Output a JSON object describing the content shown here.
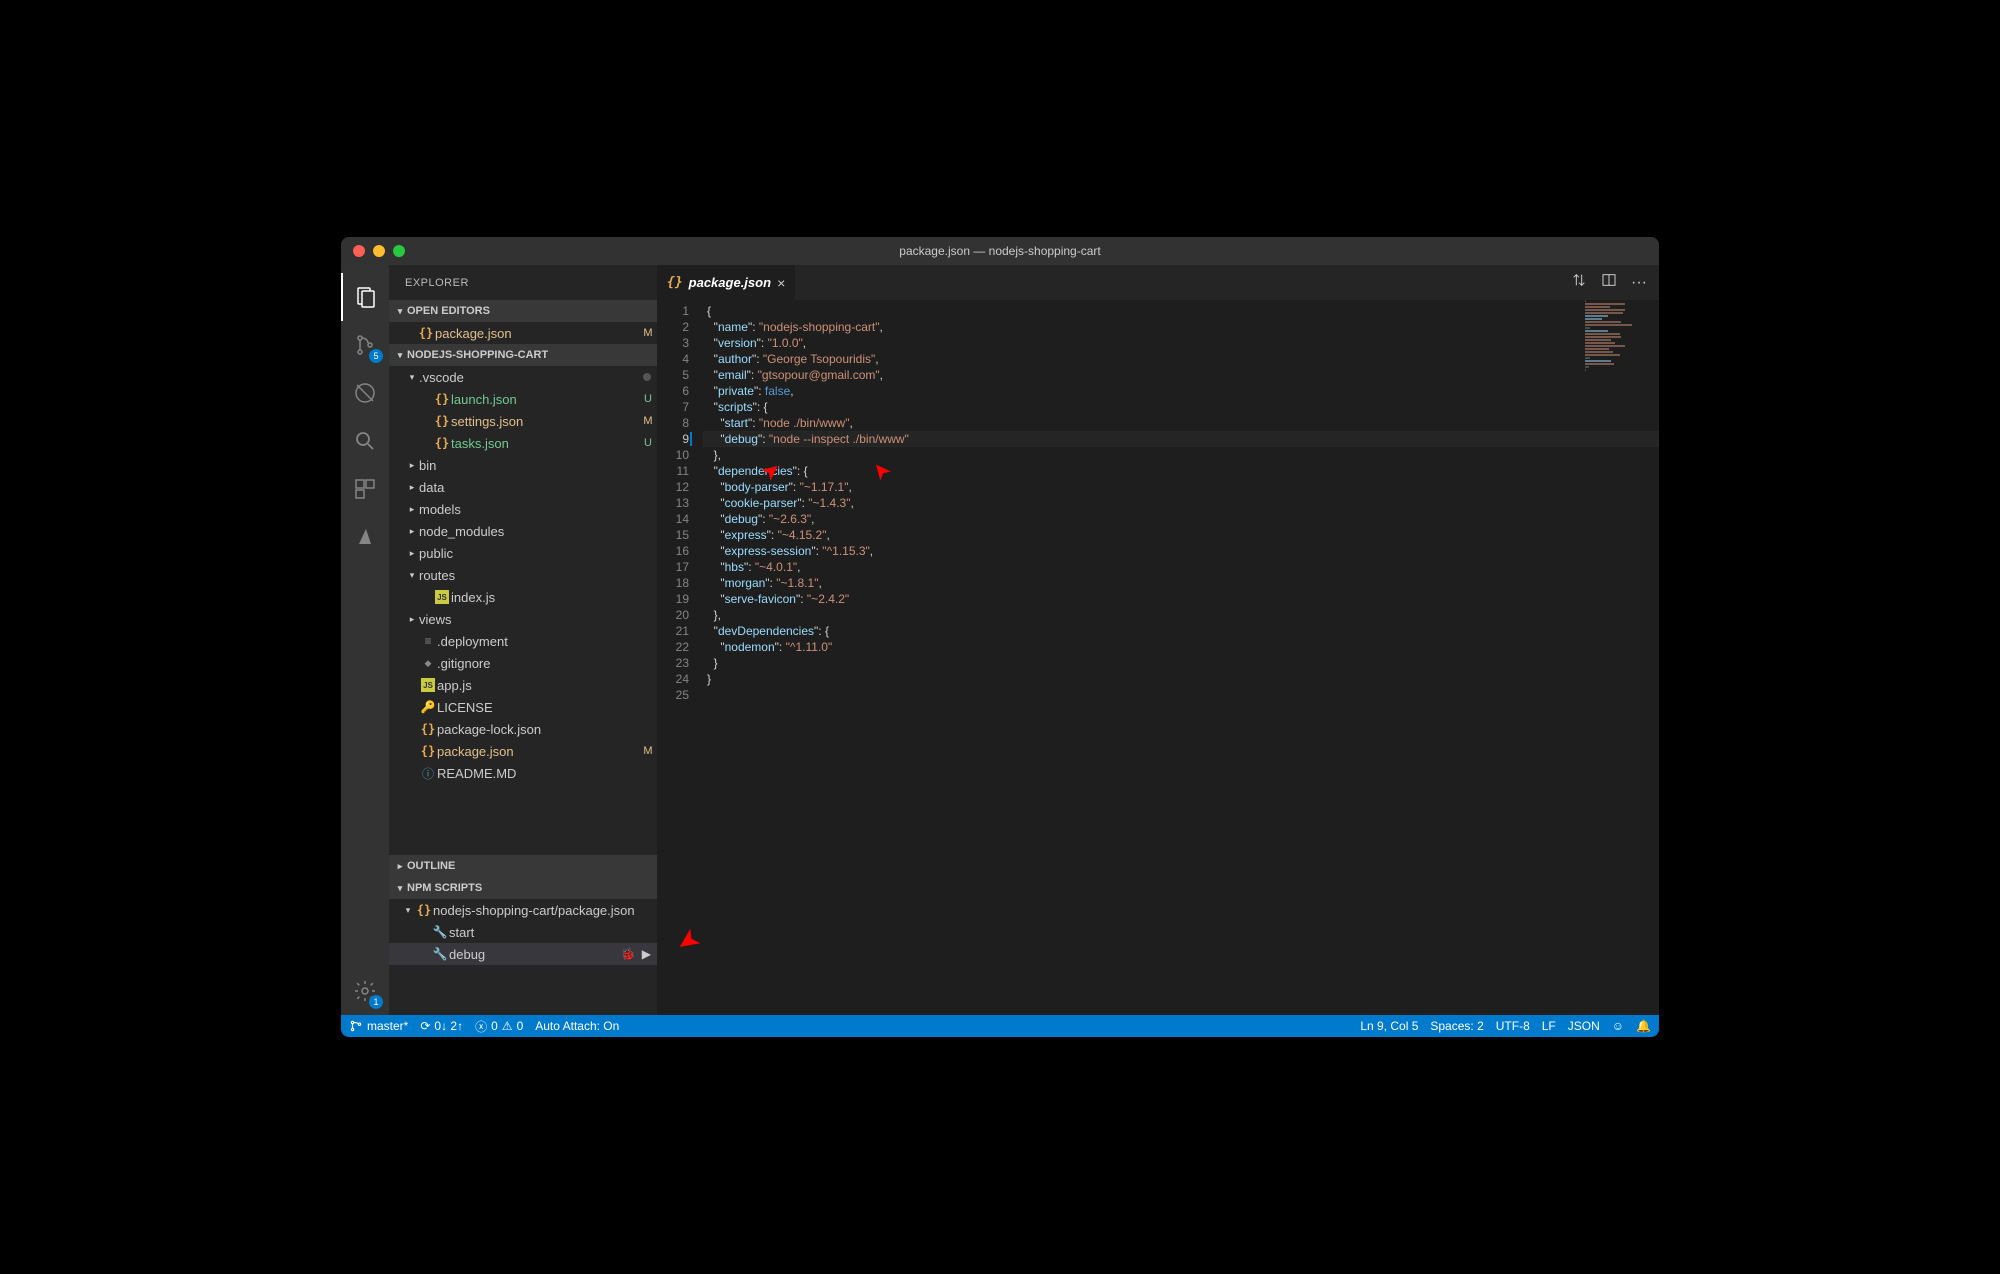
{
  "window": {
    "title": "package.json — nodejs-shopping-cart"
  },
  "activitybar": {
    "scm_badge": "5",
    "settings_badge": "1"
  },
  "sidebar": {
    "title": "EXPLORER",
    "sections": {
      "openEditors": {
        "label": "OPEN EDITORS",
        "items": [
          {
            "icon": "{}",
            "label": "package.json",
            "status": "M"
          }
        ]
      },
      "workspace": {
        "label": "NODEJS-SHOPPING-CART",
        "tree": [
          {
            "depth": 0,
            "tw": "▾",
            "icon": "",
            "label": ".vscode",
            "dot": true
          },
          {
            "depth": 1,
            "tw": "",
            "icon": "{}",
            "label": "launch.json",
            "status": "U",
            "git": "u"
          },
          {
            "depth": 1,
            "tw": "",
            "icon": "{}",
            "label": "settings.json",
            "status": "M",
            "git": "m"
          },
          {
            "depth": 1,
            "tw": "",
            "icon": "{}",
            "label": "tasks.json",
            "status": "U",
            "git": "u"
          },
          {
            "depth": 0,
            "tw": "▸",
            "icon": "",
            "label": "bin"
          },
          {
            "depth": 0,
            "tw": "▸",
            "icon": "",
            "label": "data"
          },
          {
            "depth": 0,
            "tw": "▸",
            "icon": "",
            "label": "models"
          },
          {
            "depth": 0,
            "tw": "▸",
            "icon": "",
            "label": "node_modules"
          },
          {
            "depth": 0,
            "tw": "▸",
            "icon": "",
            "label": "public"
          },
          {
            "depth": 0,
            "tw": "▾",
            "icon": "",
            "label": "routes"
          },
          {
            "depth": 1,
            "tw": "",
            "icon": "JS",
            "label": "index.js"
          },
          {
            "depth": 0,
            "tw": "▸",
            "icon": "",
            "label": "views"
          },
          {
            "depth": 0,
            "tw": "",
            "icon": "≡",
            "label": ".deployment"
          },
          {
            "depth": 0,
            "tw": "",
            "icon": "◆",
            "label": ".gitignore"
          },
          {
            "depth": 0,
            "tw": "",
            "icon": "JS",
            "label": "app.js"
          },
          {
            "depth": 0,
            "tw": "",
            "icon": "🔑",
            "label": "LICENSE"
          },
          {
            "depth": 0,
            "tw": "",
            "icon": "{}",
            "label": "package-lock.json"
          },
          {
            "depth": 0,
            "tw": "",
            "icon": "{}",
            "label": "package.json",
            "status": "M",
            "git": "m"
          },
          {
            "depth": 0,
            "tw": "",
            "icon": "ⓘ",
            "label": "README.MD"
          }
        ]
      },
      "outline": {
        "label": "OUTLINE"
      },
      "npm": {
        "label": "NPM SCRIPTS",
        "items": [
          {
            "depth": 0,
            "tw": "▾",
            "icon": "{}",
            "label": "nodejs-shopping-cart/package.json"
          },
          {
            "depth": 1,
            "tw": "",
            "icon": "🔧",
            "label": "start"
          },
          {
            "depth": 1,
            "tw": "",
            "icon": "🔧",
            "label": "debug",
            "selected": true,
            "actions": true
          }
        ]
      }
    }
  },
  "editor": {
    "tab": {
      "icon": "{}",
      "label": "package.json"
    },
    "currentLine": 9,
    "lines": [
      [
        {
          "t": "{",
          "c": ""
        }
      ],
      [
        {
          "t": "  \"",
          "c": ""
        },
        {
          "t": "name",
          "c": "k"
        },
        {
          "t": "\": ",
          "c": ""
        },
        {
          "t": "\"nodejs-shopping-cart\"",
          "c": "s"
        },
        {
          "t": ",",
          "c": ""
        }
      ],
      [
        {
          "t": "  \"",
          "c": ""
        },
        {
          "t": "version",
          "c": "k"
        },
        {
          "t": "\": ",
          "c": ""
        },
        {
          "t": "\"1.0.0\"",
          "c": "s"
        },
        {
          "t": ",",
          "c": ""
        }
      ],
      [
        {
          "t": "  \"",
          "c": ""
        },
        {
          "t": "author",
          "c": "k"
        },
        {
          "t": "\": ",
          "c": ""
        },
        {
          "t": "\"George Tsopouridis\"",
          "c": "s"
        },
        {
          "t": ",",
          "c": ""
        }
      ],
      [
        {
          "t": "  \"",
          "c": ""
        },
        {
          "t": "email",
          "c": "k"
        },
        {
          "t": "\": ",
          "c": ""
        },
        {
          "t": "\"gtsopour@gmail.com\"",
          "c": "s"
        },
        {
          "t": ",",
          "c": ""
        }
      ],
      [
        {
          "t": "  \"",
          "c": ""
        },
        {
          "t": "private",
          "c": "k"
        },
        {
          "t": "\": ",
          "c": ""
        },
        {
          "t": "false",
          "c": "c"
        },
        {
          "t": ",",
          "c": ""
        }
      ],
      [
        {
          "t": "  \"",
          "c": ""
        },
        {
          "t": "scripts",
          "c": "k"
        },
        {
          "t": "\": {",
          "c": ""
        }
      ],
      [
        {
          "t": "    \"",
          "c": ""
        },
        {
          "t": "start",
          "c": "k"
        },
        {
          "t": "\": ",
          "c": ""
        },
        {
          "t": "\"node ./bin/www\"",
          "c": "s"
        },
        {
          "t": ",",
          "c": ""
        }
      ],
      [
        {
          "t": "    \"",
          "c": ""
        },
        {
          "t": "debug",
          "c": "k"
        },
        {
          "t": "\": ",
          "c": ""
        },
        {
          "t": "\"node --inspect ./bin/www\"",
          "c": "s"
        }
      ],
      [
        {
          "t": "  },",
          "c": ""
        }
      ],
      [
        {
          "t": "  \"",
          "c": ""
        },
        {
          "t": "dependencies",
          "c": "k"
        },
        {
          "t": "\": {",
          "c": ""
        }
      ],
      [
        {
          "t": "    \"",
          "c": ""
        },
        {
          "t": "body-parser",
          "c": "k"
        },
        {
          "t": "\": ",
          "c": ""
        },
        {
          "t": "\"~1.17.1\"",
          "c": "s"
        },
        {
          "t": ",",
          "c": ""
        }
      ],
      [
        {
          "t": "    \"",
          "c": ""
        },
        {
          "t": "cookie-parser",
          "c": "k"
        },
        {
          "t": "\": ",
          "c": ""
        },
        {
          "t": "\"~1.4.3\"",
          "c": "s"
        },
        {
          "t": ",",
          "c": ""
        }
      ],
      [
        {
          "t": "    \"",
          "c": ""
        },
        {
          "t": "debug",
          "c": "k"
        },
        {
          "t": "\": ",
          "c": ""
        },
        {
          "t": "\"~2.6.3\"",
          "c": "s"
        },
        {
          "t": ",",
          "c": ""
        }
      ],
      [
        {
          "t": "    \"",
          "c": ""
        },
        {
          "t": "express",
          "c": "k"
        },
        {
          "t": "\": ",
          "c": ""
        },
        {
          "t": "\"~4.15.2\"",
          "c": "s"
        },
        {
          "t": ",",
          "c": ""
        }
      ],
      [
        {
          "t": "    \"",
          "c": ""
        },
        {
          "t": "express-session",
          "c": "k"
        },
        {
          "t": "\": ",
          "c": ""
        },
        {
          "t": "\"^1.15.3\"",
          "c": "s"
        },
        {
          "t": ",",
          "c": ""
        }
      ],
      [
        {
          "t": "    \"",
          "c": ""
        },
        {
          "t": "hbs",
          "c": "k"
        },
        {
          "t": "\": ",
          "c": ""
        },
        {
          "t": "\"~4.0.1\"",
          "c": "s"
        },
        {
          "t": ",",
          "c": ""
        }
      ],
      [
        {
          "t": "    \"",
          "c": ""
        },
        {
          "t": "morgan",
          "c": "k"
        },
        {
          "t": "\": ",
          "c": ""
        },
        {
          "t": "\"~1.8.1\"",
          "c": "s"
        },
        {
          "t": ",",
          "c": ""
        }
      ],
      [
        {
          "t": "    \"",
          "c": ""
        },
        {
          "t": "serve-favicon",
          "c": "k"
        },
        {
          "t": "\": ",
          "c": ""
        },
        {
          "t": "\"~2.4.2\"",
          "c": "s"
        }
      ],
      [
        {
          "t": "  },",
          "c": ""
        }
      ],
      [
        {
          "t": "  \"",
          "c": ""
        },
        {
          "t": "devDependencies",
          "c": "k"
        },
        {
          "t": "\": {",
          "c": ""
        }
      ],
      [
        {
          "t": "    \"",
          "c": ""
        },
        {
          "t": "nodemon",
          "c": "k"
        },
        {
          "t": "\": ",
          "c": ""
        },
        {
          "t": "\"^1.11.0\"",
          "c": "s"
        }
      ],
      [
        {
          "t": "  }",
          "c": ""
        }
      ],
      [
        {
          "t": "}",
          "c": ""
        }
      ],
      [
        {
          "t": "",
          "c": ""
        }
      ]
    ]
  },
  "statusbar": {
    "branch": "master*",
    "sync": "0↓ 2↑",
    "errors": "0",
    "warnings": "0",
    "autoattach": "Auto Attach: On",
    "position": "Ln 9, Col 5",
    "spaces": "Spaces: 2",
    "encoding": "UTF-8",
    "eol": "LF",
    "lang": "JSON"
  }
}
